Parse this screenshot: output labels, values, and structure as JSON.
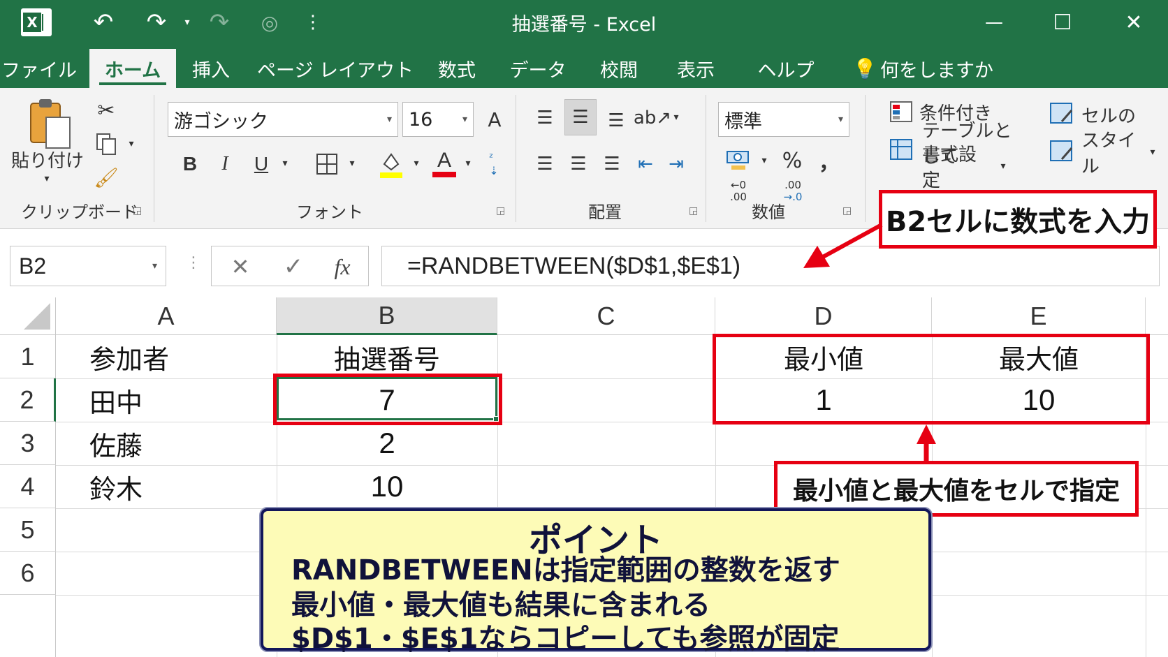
{
  "window": {
    "title": "抽選番号 - Excel",
    "controls": {
      "minimize": "—",
      "maximize": "☐",
      "close": "✕"
    },
    "quick_access": {
      "undo": "↶",
      "redo": "↷",
      "redo_disabled": "↷",
      "touch": "◎",
      "customize": "⋮"
    }
  },
  "tabs": [
    "ファイル",
    "ホーム",
    "挿入",
    "ページ レイアウト",
    "数式",
    "データ",
    "校閲",
    "表示",
    "ヘルプ"
  ],
  "active_tab": "ホーム",
  "tell_me": "何をしますか",
  "ribbon": {
    "clipboard": {
      "paste_label": "貼り付け",
      "group_label": "クリップボード"
    },
    "font": {
      "font_name": "游ゴシック",
      "font_size": "16",
      "bold": "B",
      "italic": "I",
      "underline": "U",
      "font_color_letter": "A",
      "grow_letter": "A",
      "group_label": "フォント",
      "highlight_color": "#ffff00",
      "font_color": "#e60012"
    },
    "alignment": {
      "group_label": "配置"
    },
    "number": {
      "format": "標準",
      "percent": "%",
      "comma": "，",
      "inc_decimal_top": "←0",
      "inc_decimal_bottom": ".00",
      "dec_decimal_top": ".00",
      "dec_decimal_bottom": "→.0",
      "group_label": "数値"
    },
    "styles": {
      "conditional_formatting": "条件付き",
      "format_as_table_1": "テーブルとして",
      "format_as_table_2": "書式設定",
      "cell_styles_1": "セルの",
      "cell_styles_2": "スタイル"
    }
  },
  "formula_bar": {
    "name_box": "B2",
    "cancel": "✕",
    "enter": "✓",
    "fx": "fx",
    "formula": "=RANDBETWEEN($D$1,$E$1)"
  },
  "sheet": {
    "columns": [
      "A",
      "B",
      "C",
      "D",
      "E"
    ],
    "rows": [
      "1",
      "2",
      "3",
      "4",
      "5",
      "6"
    ],
    "cells": {
      "A1": "参加者",
      "B1": "抽選番号",
      "D1": "最小値",
      "E1": "最大値",
      "A2": "田中",
      "B2": "7",
      "D2": "1",
      "E2": "10",
      "A3": "佐藤",
      "B3": "2",
      "A4": "鈴木",
      "B4": "10"
    }
  },
  "annotations": {
    "formula_callout": "B2セルに数式を入力",
    "range_callout": "最小値と最大値をセルで指定",
    "accent_color": "#e60012",
    "point": {
      "title": "ポイント",
      "lines": [
        "RANDBETWEENは指定範囲の整数を返す",
        "最小値・最大値も結果に含まれる",
        "$D$1・$E$1ならコピーしても参照が固定"
      ]
    }
  }
}
